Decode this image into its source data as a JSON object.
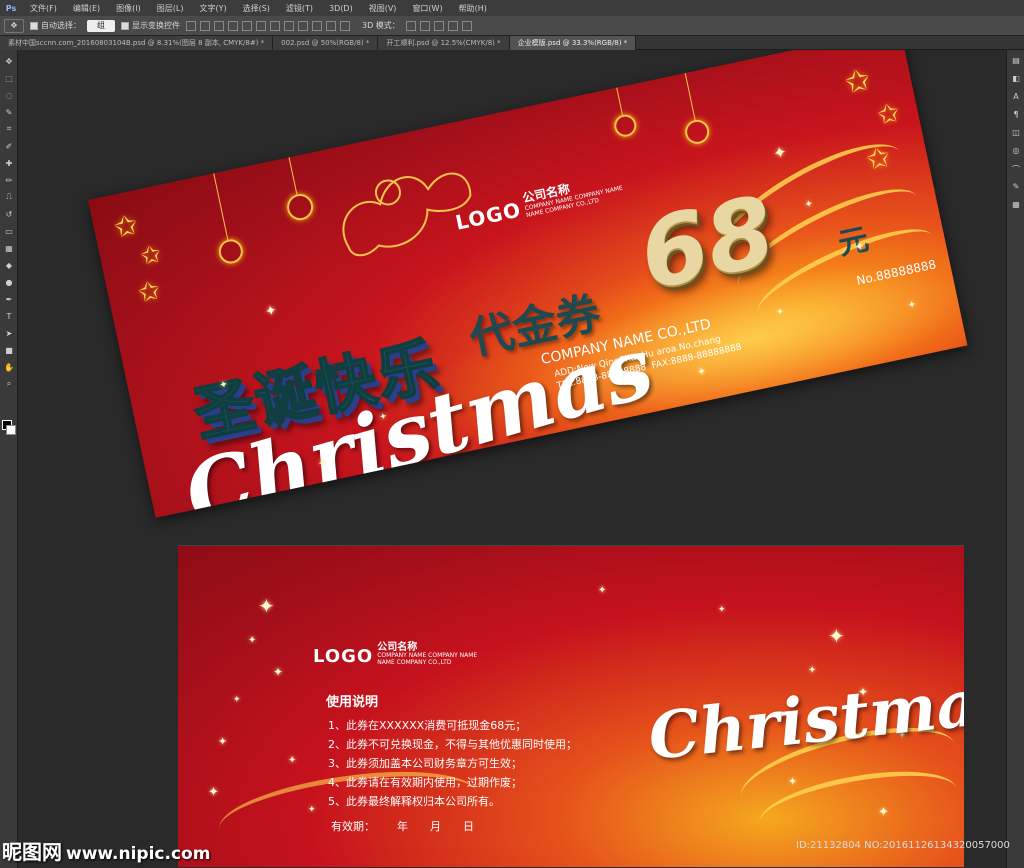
{
  "app": {
    "logo": "Ps",
    "menus": [
      "文件(F)",
      "编辑(E)",
      "图像(I)",
      "图层(L)",
      "文字(Y)",
      "选择(S)",
      "滤镜(T)",
      "3D(D)",
      "视图(V)",
      "窗口(W)",
      "帮助(H)"
    ]
  },
  "options": {
    "auto_select_label": "自动选择：",
    "auto_select_value": "组",
    "show_transform_label": "显示变换控件",
    "mode_3d_label": "3D 模式："
  },
  "tabs": [
    "素材中国sccnn.com_20160803104B.psd @ 8.31%(图层 8 副本, CMYK/8#) *",
    "002.psd @ 50%(RGB/8) *",
    "开工顺利.psd @ 12.5%(CMYK/8) *",
    "企业模版.psd @ 33.3%(RGB/8) *"
  ],
  "ticket_front": {
    "logo": "LOGO",
    "company_cn": "公司名称",
    "company_en_1": "COMPANY NAME COMPANY NAME",
    "company_en_2": "NAME COMPANY CO.,LTD",
    "greeting_cn": "圣诞快乐",
    "christmas": "Christmas",
    "voucher_label": "代金券",
    "amount": "68",
    "unit": "元",
    "number": "No.88888888",
    "company_name": "COMPANY NAME CO.,LTD",
    "address": "ADD:Now QingShanHu aroa.No.chang",
    "tel": "TEL:8888-88888888",
    "fax": "FAX:8888-88888888"
  },
  "ticket_back": {
    "logo": "LOGO",
    "company_cn": "公司名称",
    "company_en_1": "COMPANY NAME COMPANY NAME",
    "company_en_2": "NAME COMPANY CO.,LTD",
    "usage_title": "使用说明",
    "rules": [
      "1、此券在XXXXXX消费可抵现金68元；",
      "2、此券不可兑换现金，不得与其他优惠同时使用；",
      "3、此券须加盖本公司财务章方可生效；",
      "4、此券请在有效期内使用，过期作废；",
      "5、此券最终解释权归本公司所有。"
    ],
    "validity_label": "有效期：",
    "year": "年",
    "month": "月",
    "day": "日",
    "christmas": "Christmas"
  },
  "watermark": {
    "site_name": "昵图网",
    "url": "www.nipic.com",
    "id": "ID:21132804 NO:20161126134320057000"
  },
  "colors": {
    "ticket_red": "#c8141d",
    "ticket_orange": "#f7a21e",
    "teal_text": "#1f5a5e",
    "gold": "#e8d7a2",
    "ps_chrome": "#3c3c3c"
  }
}
